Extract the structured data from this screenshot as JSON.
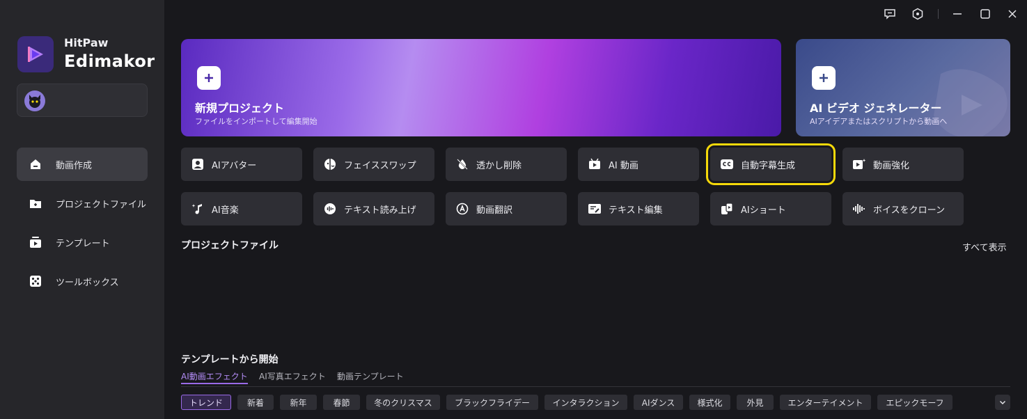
{
  "brand": {
    "small": "HitPaw",
    "big": "Edimakor"
  },
  "sidebar": {
    "items": [
      {
        "label": "動画作成",
        "icon": "home-icon",
        "active": true
      },
      {
        "label": "プロジェクトファイル",
        "icon": "folder-icon",
        "active": false
      },
      {
        "label": "テンプレート",
        "icon": "template-icon",
        "active": false
      },
      {
        "label": "ツールボックス",
        "icon": "toolbox-icon",
        "active": false
      }
    ]
  },
  "window_controls": [
    "feedback-icon",
    "settings-icon",
    "minimize-icon",
    "maximize-icon",
    "close-icon"
  ],
  "hero": {
    "new_project": {
      "title": "新規プロジェクト",
      "subtitle": "ファイルをインポートして編集開始"
    },
    "ai_video": {
      "title": "AI ビデオ ジェネレーター",
      "subtitle": "AIアイデアまたはスクリプトから動画へ"
    }
  },
  "tools": [
    {
      "label": "AIアバター",
      "icon": "avatar-icon"
    },
    {
      "label": "フェイススワップ",
      "icon": "face-swap-icon"
    },
    {
      "label": "透かし削除",
      "icon": "watermark-remove-icon"
    },
    {
      "label": "AI 動画",
      "icon": "ai-video-icon"
    },
    {
      "label": "自動字幕生成",
      "icon": "cc-icon",
      "highlighted": true
    },
    {
      "label": "動画強化",
      "icon": "enhance-icon"
    },
    {
      "label": "AI音楽",
      "icon": "music-icon"
    },
    {
      "label": "テキスト読み上げ",
      "icon": "tts-icon"
    },
    {
      "label": "動画翻訳",
      "icon": "translate-icon"
    },
    {
      "label": "テキスト編集",
      "icon": "text-edit-icon"
    },
    {
      "label": "AIショート",
      "icon": "shorts-icon"
    },
    {
      "label": "ボイスをクローン",
      "icon": "voice-clone-icon"
    }
  ],
  "projects": {
    "title": "プロジェクトファイル",
    "see_all": "すべて表示"
  },
  "templates": {
    "title": "テンプレートから開始",
    "tabs": [
      {
        "label": "AI動画エフェクト",
        "active": true
      },
      {
        "label": "AI写真エフェクト",
        "active": false
      },
      {
        "label": "動画テンプレート",
        "active": false
      }
    ],
    "chips": [
      {
        "label": "トレンド",
        "active": true
      },
      {
        "label": "新着"
      },
      {
        "label": "新年"
      },
      {
        "label": "春節"
      },
      {
        "label": "冬のクリスマス"
      },
      {
        "label": "ブラックフライデー"
      },
      {
        "label": "インタラクション"
      },
      {
        "label": "AIダンス"
      },
      {
        "label": "様式化"
      },
      {
        "label": "外見"
      },
      {
        "label": "エンターテイメント"
      },
      {
        "label": "エピックモーフ"
      }
    ]
  },
  "colors": {
    "accent": "#9a6ae8",
    "highlight": "#f5d90a",
    "sidebar": "#26262a",
    "background": "#18181c",
    "card": "#2e2e34"
  }
}
